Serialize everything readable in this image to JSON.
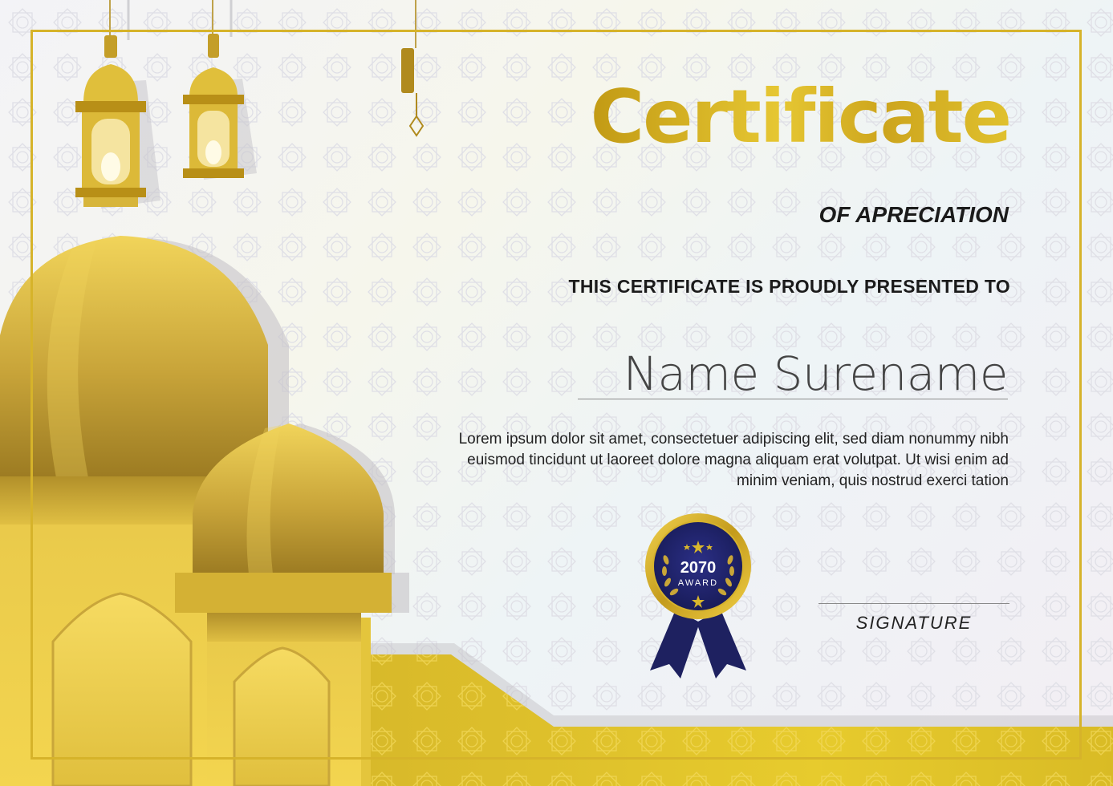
{
  "certificate": {
    "title": "Certificate",
    "subtitle": "OF APRECIATION",
    "presented_line": "THIS CERTIFICATE IS PROUDLY PRESENTED TO",
    "recipient_name": "Name Surename",
    "body_text": "Lorem ipsum dolor sit amet, consectetuer adipiscing elit, sed diam nonummy nibh euismod tincidunt ut laoreet dolore magna aliquam erat volutpat. Ut wisi enim ad minim veniam, quis nostrud exerci tation",
    "signature_label": "SIGNATURE"
  },
  "badge": {
    "year": "2070",
    "label": "AWARD"
  },
  "icons": [
    "lantern-icon",
    "crescent-moon-icon",
    "mosque-dome-icon",
    "award-medal-icon",
    "laurel-icon",
    "star-icon",
    "ribbon-icon"
  ],
  "colors": {
    "gold": "#d9b72c",
    "gold_dark": "#9e7a14",
    "navy": "#1e2160",
    "text": "#1b1b1b",
    "frame": "#d6b32a"
  }
}
